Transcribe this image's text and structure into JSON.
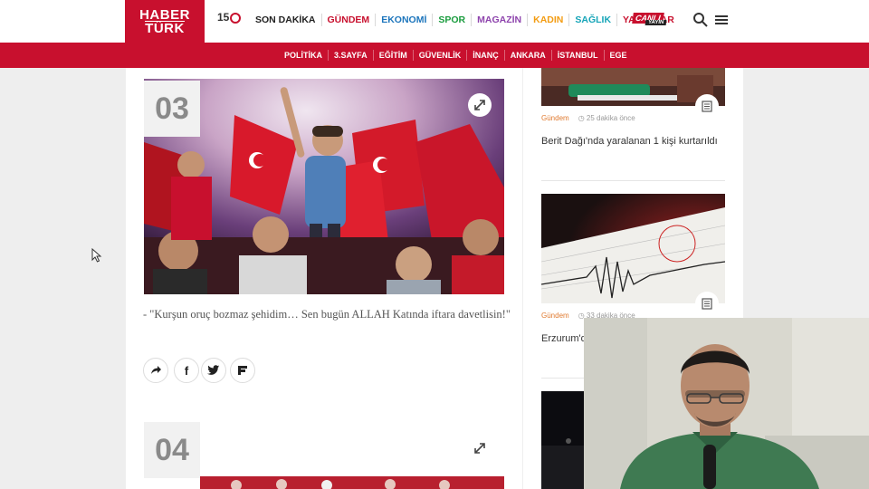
{
  "header": {
    "logo_line1": "HABER",
    "logo_line2": "TÜRK",
    "badge": "15",
    "nav": [
      {
        "label": "SON DAKİKA",
        "color": "#222222"
      },
      {
        "label": "GÜNDEM",
        "color": "#c8102e"
      },
      {
        "label": "EKONOMİ",
        "color": "#1c75bc"
      },
      {
        "label": "SPOR",
        "color": "#1a9c3e"
      },
      {
        "label": "MAGAZİN",
        "color": "#8e44ad"
      },
      {
        "label": "KADIN",
        "color": "#f39c12"
      },
      {
        "label": "SAĞLIK",
        "color": "#16a5b8"
      },
      {
        "label": "YAZARLAR",
        "color": "#c8102e"
      }
    ],
    "live_top": "CANLI",
    "live_bottom": "YAYIN",
    "search_icon": "search-icon",
    "menu_icon": "hamburger-menu-icon"
  },
  "subnav": [
    "POLİTİKA",
    "3.SAYFA",
    "EĞİTİM",
    "GÜVENLİK",
    "İNANÇ",
    "ANKARA",
    "İSTANBUL",
    "EGE"
  ],
  "article": {
    "item3_number": "03",
    "caption": "- \"Kurşun oruç bozmaz şehidim… Sen bugün ALLAH Katında iftara davetlisin!\"",
    "item4_number": "04",
    "share_icons": [
      "share-arrow-icon",
      "facebook-icon",
      "twitter-icon",
      "flipboard-icon"
    ]
  },
  "sidebar": {
    "items": [
      {
        "category": "Gündem",
        "time": "25 dakika önce",
        "headline": "Berit Dağı'nda yaralanan 1 kişi kurtarıldı"
      },
      {
        "category": "Gündem",
        "time": "33 dakika önce",
        "headline": "Erzurum'd"
      }
    ]
  },
  "colors": {
    "brand": "#c8102e",
    "category": "#e07a2f"
  }
}
